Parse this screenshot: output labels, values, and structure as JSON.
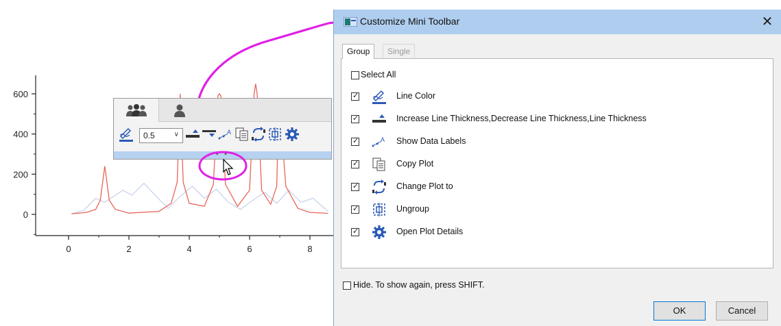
{
  "chart_data": {
    "type": "line",
    "title": "",
    "xlabel": "",
    "ylabel": "",
    "x_ticks": [
      "0",
      "2",
      "4",
      "6",
      "8"
    ],
    "y_ticks": [
      "600",
      "400",
      "200",
      "0"
    ],
    "xlim": [
      -0.8,
      8.8
    ],
    "ylim": [
      -100,
      700
    ],
    "series": [
      {
        "color": "#e8645a",
        "x": [
          0.1,
          0.6,
          0.9,
          1.05,
          1.2,
          1.35,
          1.55,
          2.0,
          3.0,
          3.4,
          3.6,
          3.7,
          3.8,
          4.0,
          4.5,
          4.8,
          4.95,
          5.0,
          5.05,
          5.2,
          5.6,
          6.0,
          6.15,
          6.2,
          6.25,
          6.4,
          6.7,
          6.9,
          6.95,
          7.0,
          7.05,
          7.2,
          7.6,
          8.0,
          8.6
        ],
        "y": [
          3,
          10,
          25,
          70,
          240,
          70,
          25,
          6,
          15,
          55,
          160,
          600,
          160,
          55,
          40,
          150,
          590,
          600,
          590,
          150,
          40,
          120,
          600,
          650,
          600,
          120,
          50,
          140,
          440,
          460,
          440,
          140,
          30,
          10,
          5
        ]
      },
      {
        "color": "#c9d4ea",
        "x": [
          0.1,
          0.5,
          0.9,
          1.2,
          1.5,
          1.8,
          2.1,
          2.5,
          2.9,
          3.3,
          3.7,
          4.1,
          4.5,
          4.9,
          5.3,
          5.7,
          6.1,
          6.5,
          6.9,
          7.3,
          7.7,
          8.1,
          8.6
        ],
        "y": [
          2,
          20,
          80,
          60,
          90,
          120,
          95,
          155,
          90,
          30,
          90,
          140,
          80,
          125,
          60,
          25,
          70,
          110,
          55,
          120,
          60,
          80,
          15
        ]
      }
    ]
  },
  "mini_toolbar": {
    "tabs": [
      {
        "icon": "group-users-icon",
        "active": true
      },
      {
        "icon": "single-user-icon",
        "active": false
      }
    ],
    "thickness_value": "0.5",
    "buttons": [
      "line-color-icon",
      "increase-thickness-icon",
      "decrease-thickness-icon",
      "show-data-labels-icon",
      "copy-plot-icon",
      "change-plot-icon",
      "ungroup-icon",
      "plot-details-gear-icon"
    ],
    "grip": "• • •"
  },
  "annotation": {
    "color": "#e020e6"
  },
  "dialog": {
    "title": "Customize Mini Toolbar",
    "close": "✕",
    "tabs": {
      "group": "Group",
      "single": "Single"
    },
    "select_all": "Select All",
    "items": [
      {
        "label": "Line Color",
        "icon": "line-color-icon",
        "checked": true
      },
      {
        "label": "Increase Line Thickness,Decrease Line Thickness,Line Thickness",
        "icon": "line-thickness-icon",
        "checked": true
      },
      {
        "label": "Show Data Labels",
        "icon": "data-labels-icon",
        "checked": true
      },
      {
        "label": "Copy Plot",
        "icon": "copy-plot-icon",
        "checked": true
      },
      {
        "label": "Change Plot to",
        "icon": "change-plot-icon",
        "checked": true
      },
      {
        "label": "Ungroup",
        "icon": "ungroup-icon",
        "checked": true
      },
      {
        "label": "Open Plot Details",
        "icon": "gear-icon",
        "checked": true
      }
    ],
    "hide_label": "Hide. To show again, press SHIFT.",
    "ok": "OK",
    "cancel": "Cancel"
  }
}
